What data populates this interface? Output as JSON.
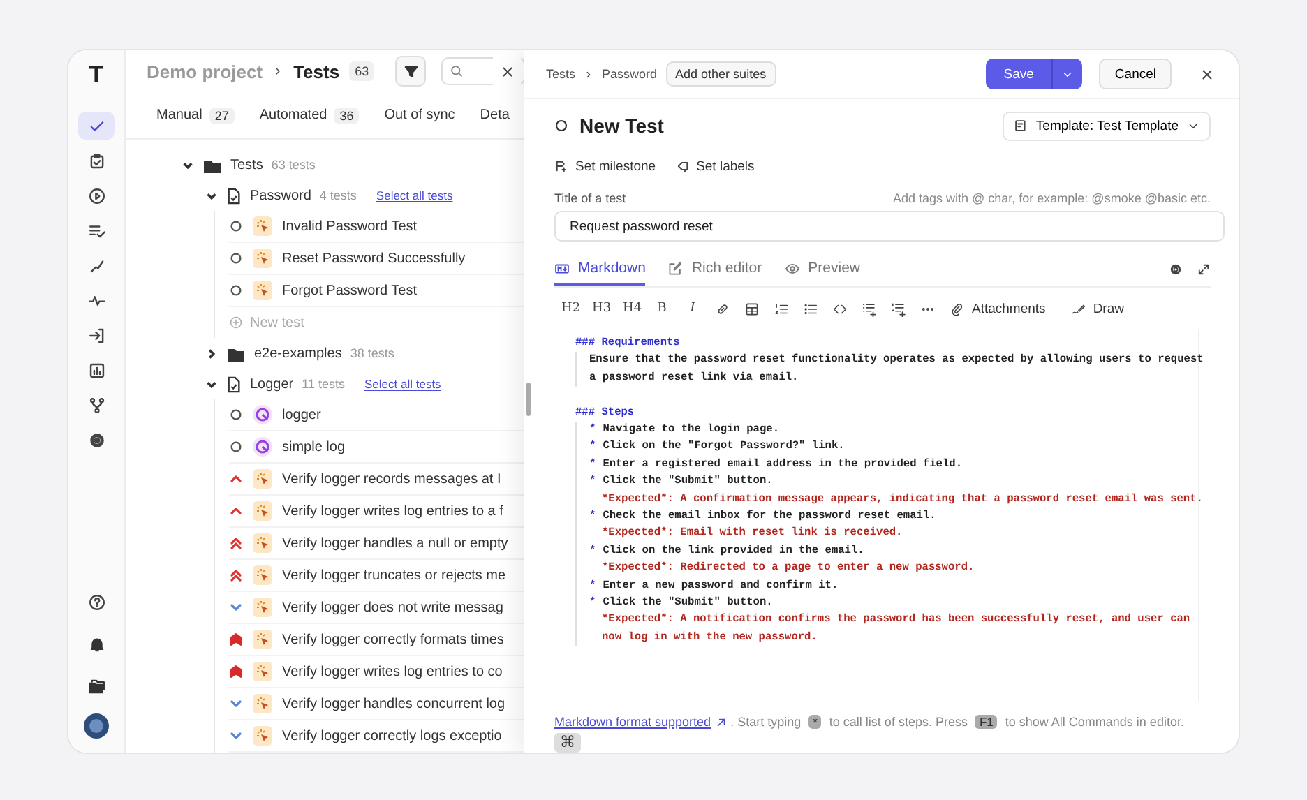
{
  "sidebar": {
    "logo": "T",
    "nav": [
      {
        "selected": true
      },
      {
        "selected": false
      },
      {
        "selected": false
      },
      {
        "selected": false
      },
      {
        "selected": false
      },
      {
        "selected": false
      },
      {
        "selected": false
      },
      {
        "selected": false
      },
      {
        "selected": false
      },
      {
        "selected": false
      }
    ]
  },
  "list_header": {
    "project": "Demo project",
    "page": "Tests",
    "count": "63"
  },
  "tabs": [
    {
      "label": "Manual",
      "count": "27",
      "selected": false
    },
    {
      "label": "Automated",
      "count": "36",
      "selected": false
    },
    {
      "label": "Out of sync",
      "selected": false
    },
    {
      "label": "Deta",
      "selected": false
    }
  ],
  "tree": [
    {
      "kind": "folder",
      "name": "Tests",
      "count": "63 tests",
      "expanded": true,
      "children": [
        {
          "kind": "suite",
          "name": "Password",
          "count": "4 tests",
          "action": "Select all tests",
          "expanded": true,
          "children": [
            {
              "kind": "test",
              "priority": {
                "kind": "normal"
              },
              "type": {
                "kind": "manual"
              },
              "name": "Invalid Password Test"
            },
            {
              "kind": "test",
              "priority": {
                "kind": "normal"
              },
              "type": {
                "kind": "manual"
              },
              "name": "Reset Password Successfully"
            },
            {
              "kind": "test",
              "priority": {
                "kind": "normal"
              },
              "type": {
                "kind": "manual"
              },
              "name": "Forgot Password Test"
            },
            {
              "kind": "new",
              "name": "New test"
            }
          ]
        },
        {
          "kind": "folder",
          "name": "e2e-examples",
          "count": "38 tests",
          "expanded": false
        },
        {
          "kind": "suite",
          "name": "Logger",
          "count": "11 tests",
          "action": "Select all tests",
          "expanded": true,
          "children": [
            {
              "kind": "test",
              "priority": {
                "kind": "normal"
              },
              "type": {
                "kind": "automated"
              },
              "name": "logger"
            },
            {
              "kind": "test",
              "priority": {
                "kind": "normal"
              },
              "type": {
                "kind": "automated"
              },
              "name": "simple log"
            },
            {
              "kind": "test",
              "priority": {
                "kind": "high"
              },
              "type": {
                "kind": "manual"
              },
              "name": "Verify logger records messages at I"
            },
            {
              "kind": "test",
              "priority": {
                "kind": "high"
              },
              "type": {
                "kind": "manual"
              },
              "name": "Verify logger writes log entries to a f"
            },
            {
              "kind": "test",
              "priority": {
                "kind": "critical"
              },
              "type": {
                "kind": "manual"
              },
              "name": "Verify logger handles a null or empty"
            },
            {
              "kind": "test",
              "priority": {
                "kind": "critical"
              },
              "type": {
                "kind": "manual"
              },
              "name": "Verify logger truncates or rejects me"
            },
            {
              "kind": "test",
              "priority": {
                "kind": "low"
              },
              "type": {
                "kind": "manual"
              },
              "name": "Verify logger does not write messag"
            },
            {
              "kind": "test",
              "priority": {
                "kind": "blocker"
              },
              "type": {
                "kind": "manual"
              },
              "name": "Verify logger correctly formats times"
            },
            {
              "kind": "test",
              "priority": {
                "kind": "blocker"
              },
              "type": {
                "kind": "manual"
              },
              "name": "Verify logger writes log entries to co"
            },
            {
              "kind": "test",
              "priority": {
                "kind": "low"
              },
              "type": {
                "kind": "manual"
              },
              "name": "Verify logger handles concurrent log"
            },
            {
              "kind": "test",
              "priority": {
                "kind": "low"
              },
              "type": {
                "kind": "manual"
              },
              "name": "Verify logger correctly logs exceptio"
            }
          ]
        }
      ]
    }
  ],
  "drawer": {
    "breadcrumb": [
      "Tests",
      "Password"
    ],
    "add_suites": "Add other suites",
    "save": "Save",
    "cancel": "Cancel",
    "title": "New Test",
    "template": "Template: Test Template",
    "actions": [
      "Set milestone",
      "Set labels"
    ],
    "field": {
      "label": "Title of a test",
      "hint": "Add tags with @ char, for example: @smoke @basic etc.",
      "value": "Request password reset"
    },
    "editor_tabs": [
      {
        "label": "Markdown",
        "selected": true
      },
      {
        "label": "Rich editor",
        "selected": false
      },
      {
        "label": "Preview",
        "selected": false
      }
    ],
    "toolbar": {
      "text_buttons": [
        "H2",
        "H3",
        "H4",
        "B",
        "I"
      ],
      "attachments": "Attachments",
      "draw": "Draw"
    },
    "editor_lines": [
      {
        "kind": "heading",
        "text": "### Requirements"
      },
      {
        "kind": "text",
        "text": "Ensure that the password reset functionality operates as expected by allowing users to request"
      },
      {
        "kind": "text",
        "text": "a password reset link via email."
      },
      {
        "kind": "heading",
        "text": "### Steps"
      },
      {
        "kind": "step",
        "marker": "*",
        "text": "Navigate to the login page."
      },
      {
        "kind": "step",
        "marker": "*",
        "text": "Click on the \"Forgot Password?\" link."
      },
      {
        "kind": "step",
        "marker": "*",
        "text": "Enter a registered email address in the provided field."
      },
      {
        "kind": "step",
        "marker": "*",
        "text": "Click the \"Submit\" button."
      },
      {
        "kind": "expected",
        "text": "*Expected*: A confirmation message appears, indicating that a password reset email was sent."
      },
      {
        "kind": "step",
        "marker": "*",
        "text": "Check the email inbox for the password reset email."
      },
      {
        "kind": "expected",
        "text": "*Expected*: Email with reset link is received."
      },
      {
        "kind": "step",
        "marker": "*",
        "text": "Click on the link provided in the email."
      },
      {
        "kind": "expected",
        "text": "*Expected*: Redirected to a page to enter a new password."
      },
      {
        "kind": "step",
        "marker": "*",
        "text": "Enter a new password and confirm it."
      },
      {
        "kind": "step",
        "marker": "*",
        "text": "Click the \"Submit\" button."
      },
      {
        "kind": "expected",
        "text": "*Expected*: A notification confirms the password has been successfully reset, and user can"
      },
      {
        "kind": "expected",
        "text": "now log in with the new password."
      }
    ],
    "footer": [
      {
        "kind": "link",
        "text": "Markdown format supported"
      },
      {
        "kind": "text",
        "text": ". Start typing"
      },
      {
        "kind": "key",
        "text": "*"
      },
      {
        "kind": "text",
        "text": "to call list of steps. Press"
      },
      {
        "kind": "key",
        "text": "F1"
      },
      {
        "kind": "text",
        "text": "to show All Commands in editor."
      }
    ],
    "footer_key": "⌘"
  }
}
